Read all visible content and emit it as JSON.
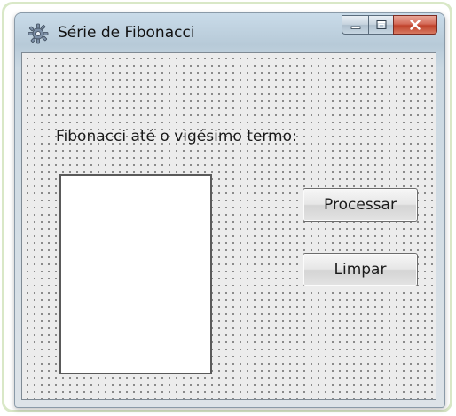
{
  "window": {
    "title": "Série de Fibonacci",
    "icon": "gear-app-icon",
    "controls": {
      "minimize": "minimize-icon",
      "maximize": "maximize-icon",
      "close": "close-icon"
    }
  },
  "form": {
    "label": "Fibonacci até o vigésimo termo:",
    "process_button": "Processar",
    "clear_button": "Limpar",
    "result_list": []
  },
  "colors": {
    "close_button": "#c0422b",
    "client_background": "#ececec"
  }
}
